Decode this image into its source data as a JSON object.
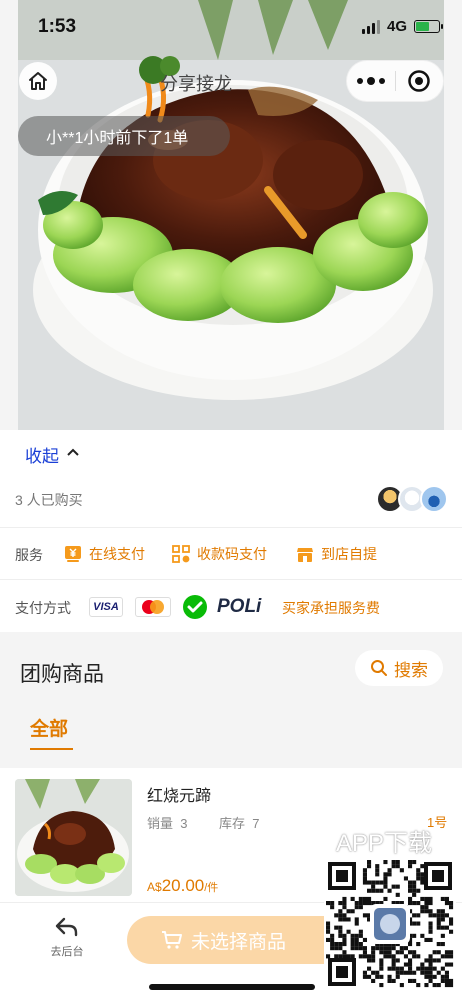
{
  "status_bar": {
    "time": "1:53",
    "network": "4G"
  },
  "nav": {
    "title": "分享接龙"
  },
  "toast": {
    "text": "小**1小时前下了1单"
  },
  "collapse": {
    "label": "收起"
  },
  "buyers": {
    "text": "3 人已购买"
  },
  "service": {
    "label": "服务",
    "items": [
      {
        "label": "在线支付",
        "icon": "yen-card-icon"
      },
      {
        "label": "收款码支付",
        "icon": "qr-code-icon"
      },
      {
        "label": "到店自提",
        "icon": "store-icon"
      }
    ]
  },
  "payment": {
    "label": "支付方式",
    "methods": [
      "VISA",
      "MasterCard",
      "WeChat Pay",
      "POLi"
    ],
    "visa_text": "VISA",
    "poli_text": "POLi",
    "fee_note": "买家承担服务费"
  },
  "group": {
    "title": "团购商品",
    "search_label": "搜索",
    "tabs": [
      {
        "label": "全部",
        "active": true
      }
    ]
  },
  "product": {
    "name": "红烧元蹄",
    "sales_label": "销量",
    "sales": "3",
    "stock_label": "库存",
    "stock": "7",
    "badge": "1号",
    "currency": "A$",
    "price": "20.00",
    "unit": "/件"
  },
  "overlay": {
    "app_download": "APP下载"
  },
  "bottom_bar": {
    "back_label": "去后台",
    "cart_label": "未选择商品"
  },
  "colors": {
    "accent": "#e07a00",
    "link": "#1a3fd6",
    "cart_bg": "#fbd7a7"
  }
}
